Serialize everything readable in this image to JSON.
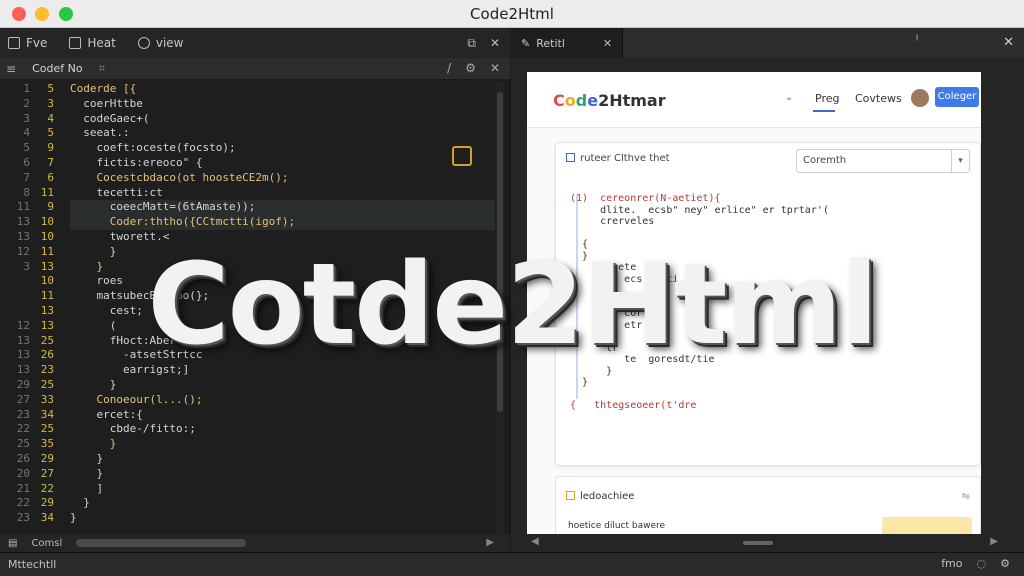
{
  "window": {
    "title": "Code2Html"
  },
  "editor": {
    "menu": [
      {
        "label": "Fve",
        "icon": "file-icon"
      },
      {
        "label": "Heat",
        "icon": "folder-icon"
      },
      {
        "label": "view",
        "icon": "search-icon"
      }
    ],
    "tab": {
      "label": "Codef No"
    },
    "lines": [
      {
        "n1": "1",
        "n2": "5",
        "text": "Coderde [{"
      },
      {
        "n1": "2",
        "n2": "3",
        "text": "  coerHttbe"
      },
      {
        "n1": "3",
        "n2": "4",
        "text": "  codeGaec+("
      },
      {
        "n1": "4",
        "n2": "5",
        "text": "  seeat.:"
      },
      {
        "n1": "5",
        "n2": "9",
        "text": "    coeft:oceste(focsto);"
      },
      {
        "n1": "6",
        "n2": "7",
        "text": "    fictis:ereoco\" {"
      },
      {
        "n1": "7",
        "n2": "6",
        "text": "    Cocestcbdaco(ot hoosteCE2m();"
      },
      {
        "n1": "8",
        "n2": "11",
        "text": "    tecetti:ct"
      },
      {
        "n1": "11",
        "n2": "9",
        "text": "      coeecMatt=(6tAmaste));"
      },
      {
        "n1": "13",
        "n2": "10",
        "text": "      Coder:ththo({CCtmctti(igof);"
      },
      {
        "n1": "13",
        "n2": "10",
        "text": "      tworett.<"
      },
      {
        "n1": "12",
        "n2": "11",
        "text": "      }"
      },
      {
        "n1": "3",
        "n2": "13",
        "text": "    }"
      },
      {
        "n1": "",
        "n2": "10",
        "text": "    roes"
      },
      {
        "n1": "",
        "n2": "11",
        "text": "    matsubecBcztbo(};"
      },
      {
        "n1": "",
        "n2": "13",
        "text": "      cest;"
      },
      {
        "n1": "12",
        "n2": "13",
        "text": "      ("
      },
      {
        "n1": "13",
        "n2": "25",
        "text": "      fHoct:Aber"
      },
      {
        "n1": "13",
        "n2": "26",
        "text": "        -atsetStrtcc"
      },
      {
        "n1": "13",
        "n2": "23",
        "text": "        earrigst;]"
      },
      {
        "n1": "29",
        "n2": "25",
        "text": "      }"
      },
      {
        "n1": "27",
        "n2": "33",
        "text": "    Conoeour(l...();"
      },
      {
        "n1": "23",
        "n2": "34",
        "text": "    ercet:{"
      },
      {
        "n1": "22",
        "n2": "25",
        "text": "      cbde-/fitto:;"
      },
      {
        "n1": "25",
        "n2": "35",
        "text": "      }"
      },
      {
        "n1": "26",
        "n2": "29",
        "text": "    }"
      },
      {
        "n1": "20",
        "n2": "27",
        "text": "    }"
      },
      {
        "n1": "21",
        "n2": "22",
        "text": "    ]"
      },
      {
        "n1": "22",
        "n2": "29",
        "text": "  }"
      },
      {
        "n1": "23",
        "n2": "34",
        "text": "}"
      }
    ],
    "footer_label": "Comsl"
  },
  "preview": {
    "tab_label": "Retitl",
    "page": {
      "logo": "Code2Htmar",
      "nav": [
        "Preg",
        "Covtews"
      ],
      "button": "Coleger",
      "card_title": "ruteer Clthve thet",
      "select_value": "Coremth",
      "code": [
        "(1)  cereonrer(N-aetiet){",
        "     dlite.  ecsb\" ney\" erlice\" er tprtar'(",
        "     crerveles",
        "",
        "  {",
        "  }",
        "     curete  cty",
        "         ecs'  sti",
        "",
        "",
        "         cort",
        "         etr",
        "",
        "      tr",
        "         te  goresdt/tie",
        "      }",
        "  }",
        "",
        "{   thtegseoeer(t'dre"
      ],
      "card2_title": "ledoachiee",
      "card2_row": "hoetice diluct bawere"
    }
  },
  "statusbar": {
    "left": "Mttechtll",
    "right": [
      "fmo"
    ]
  },
  "overlay_title": "Cotde2Html"
}
